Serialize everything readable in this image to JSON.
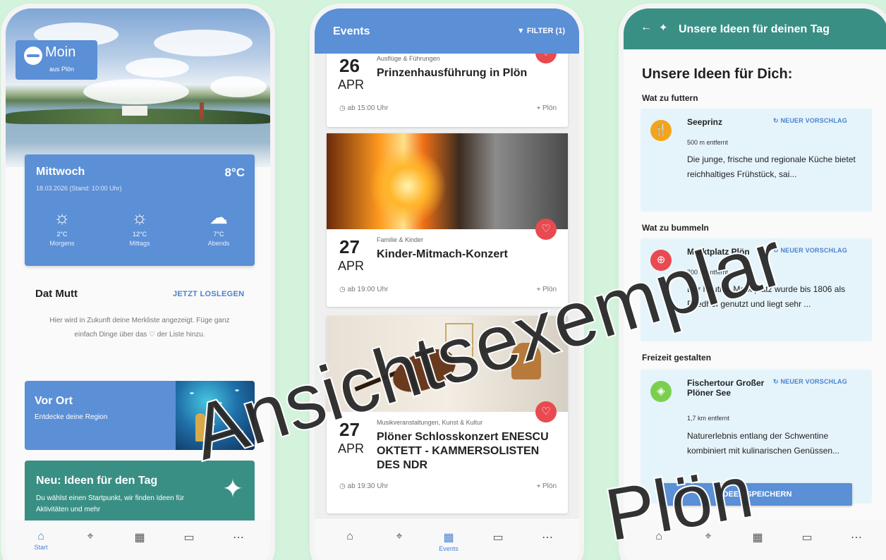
{
  "phone1": {
    "greeting": "Moin",
    "location": "aus Plön",
    "weather": {
      "day": "Mittwoch",
      "temp": "8°C",
      "date": "18.03.2026 (Stand: 10:00 Uhr)",
      "slots": [
        {
          "temp": "2°C",
          "label": "Morgens",
          "icon": "sun-icon"
        },
        {
          "temp": "12°C",
          "label": "Mittags",
          "icon": "sun-icon"
        },
        {
          "temp": "7°C",
          "label": "Abends",
          "icon": "cloud-sun-icon"
        }
      ]
    },
    "merkliste": {
      "title": "Dat Mutt",
      "action": "JETZT LOSLEGEN",
      "text": "Hier wird in Zukunft deine Merkliste angezeigt. Füge ganz einfach Dinge über das ♡ der Liste hinzu."
    },
    "vor_ort": {
      "title": "Vor Ort",
      "subtitle": "Entdecke deine Region"
    },
    "ideen": {
      "title": "Neu: Ideen für den Tag",
      "subtitle": "Du wählst einen Startpunkt, wir finden Ideen für Aktivitäten und mehr"
    },
    "nav": {
      "start": "Start"
    }
  },
  "phone2": {
    "title": "Events",
    "filter": "FILTER (1)",
    "events": [
      {
        "day": "26",
        "month": "APR",
        "category": "Ausflüge & Führungen",
        "name": "Prinzenhausführung in Plön",
        "time": "ab 15:00 Uhr",
        "place": "Plön"
      },
      {
        "day": "27",
        "month": "APR",
        "category": "Familie & Kinder",
        "name": "Kinder-Mitmach-Konzert",
        "time": "ab 19:00 Uhr",
        "place": "Plön"
      },
      {
        "day": "27",
        "month": "APR",
        "category": "Musikveranstaltungen, Kunst & Kultur",
        "name": "Plöner Schlosskonzert ENESCU OKTETT - KAMMERSOLISTEN DES NDR",
        "time": "ab 19:30 Uhr",
        "place": "Plön"
      }
    ],
    "nav": {
      "events": "Events"
    }
  },
  "phone3": {
    "title": "Unsere Ideen für deinen Tag",
    "heading": "Unsere Ideen für Dich:",
    "new_suggestion": "NEUER VORSCHLAG",
    "sections": [
      {
        "title": "Wat zu futtern",
        "name": "Seeprinz",
        "distance": "500 m entfernt",
        "desc": "Die junge, frische und regionale Küche bietet reichhaltiges Frühstück, sai...",
        "icon": "restaurant-icon",
        "color": "#f2a41b"
      },
      {
        "title": "Wat zu bummeln",
        "name": "Marktplatz Plön",
        "distance": "700 m entfernt",
        "desc": "Der heutige Marktplatz wurde bis 1806 als Friedhof genutzt und liegt sehr ...",
        "icon": "shopping-basket-icon",
        "color": "#e84a50"
      },
      {
        "title": "Freizeit gestalten",
        "name": "Fischertour Großer Plöner See",
        "distance": "1,7 km entfernt",
        "desc": "Naturerlebnis entlang der Schwentine kombiniert mit kulinarischen Genüssen...",
        "icon": "ticket-icon",
        "color": "#7ccf4e"
      }
    ],
    "save_button": "IDEEN SPEICHERN"
  },
  "watermark": {
    "line1": "Ansichtsexemplar",
    "line2": "Plön"
  }
}
